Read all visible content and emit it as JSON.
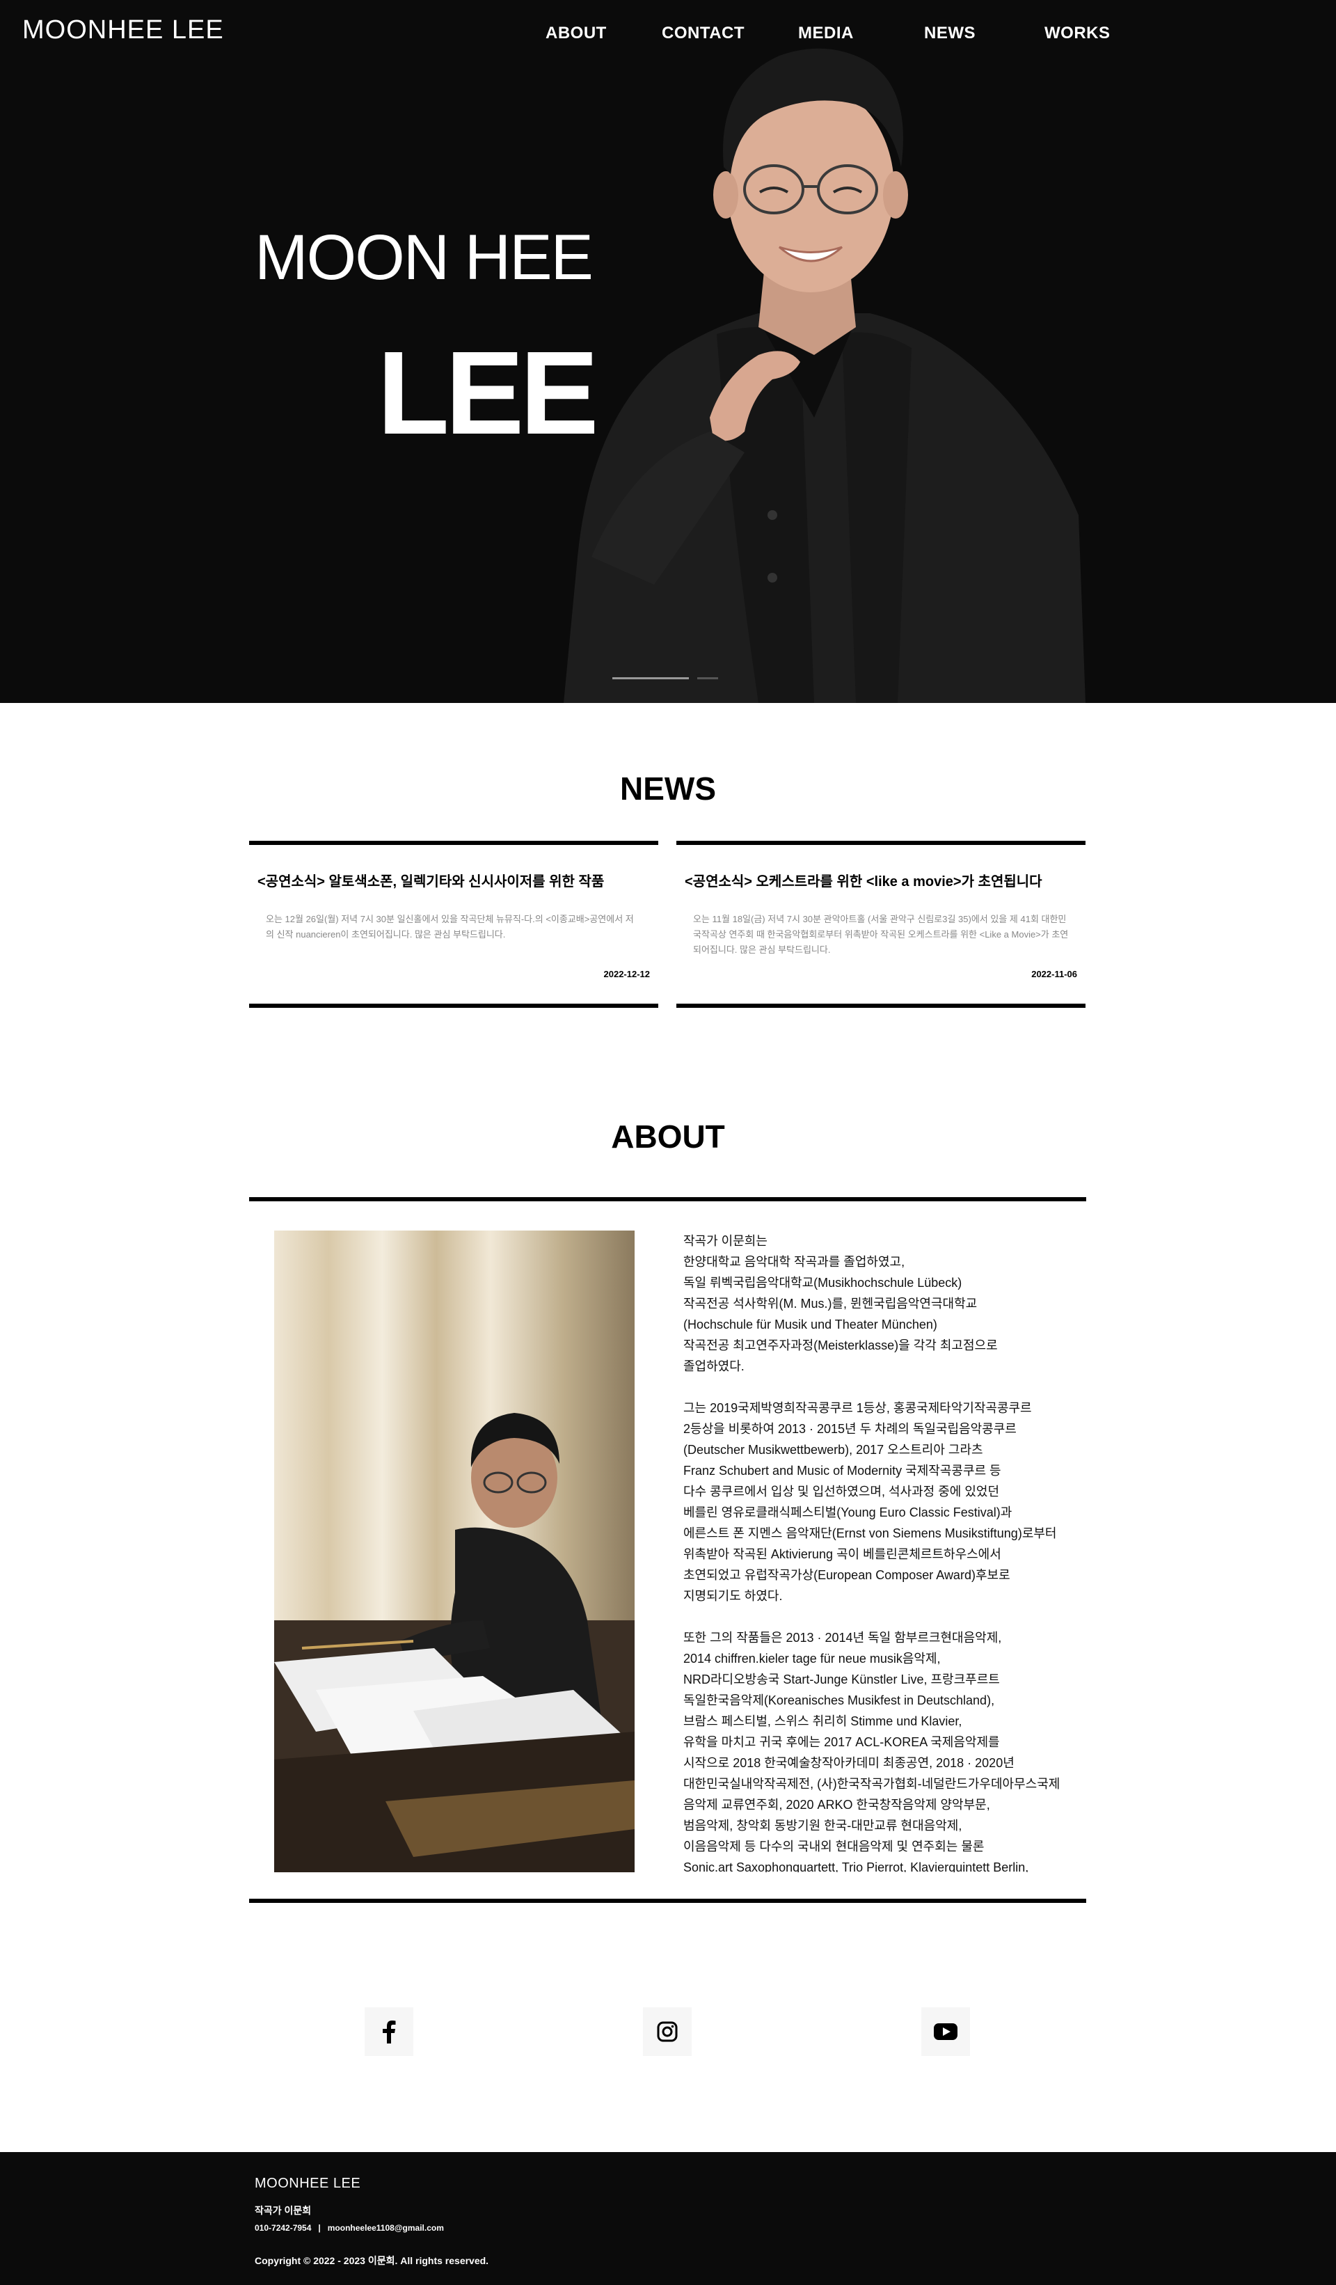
{
  "header": {
    "logo": "MOONHEE LEE",
    "nav": [
      {
        "label": "ABOUT"
      },
      {
        "label": "CONTACT"
      },
      {
        "label": "MEDIA"
      },
      {
        "label": "NEWS"
      },
      {
        "label": "WORKS"
      }
    ]
  },
  "hero": {
    "title_line1": "MOON HEE",
    "title_line2": "LEE"
  },
  "news": {
    "heading": "NEWS",
    "items": [
      {
        "title": "<공연소식> 알토색소폰, 일렉기타와 신시사이저를 위한 작품",
        "body": "오는 12월 26일(월) 저녁 7시 30분 일신홀에서 있을 작곡단체 뉴뮤직-다.의 <이종교배>공연에서 저의 신작 nuancieren이 초연되어집니다. 많은 관심 부탁드립니다.",
        "date": "2022-12-12"
      },
      {
        "title": "<공연소식> 오케스트라를 위한 <like a movie>가 초연됩니다",
        "body": "오는 11월 18일(금) 저녁 7시 30분 관악아트홀 (서울 관악구 신림로3길 35)에서 있을 제 41회 대한민국작곡상 연주회 때 한국음악협회로부터 위촉받아 작곡된 오케스트라를 위한 <Like a Movie>가 초연되어집니다. 많은 관심 부탁드립니다.",
        "date": "2022-11-06"
      }
    ]
  },
  "about": {
    "heading": "ABOUT",
    "paragraphs": [
      "작곡가 이문희는\n한양대학교 음악대학 작곡과를 졸업하였고,\n독일 뤼벡국립음악대학교(Musikhochschule Lübeck)\n작곡전공 석사학위(M. Mus.)를, 뮌헨국립음악연극대학교\n(Hochschule für Musik und Theater München)\n작곡전공 최고연주자과정(Meisterklasse)을 각각 최고점으로\n졸업하였다.",
      "그는 2019국제박영희작곡콩쿠르 1등상, 홍콩국제타악기작곡콩쿠르\n2등상을 비롯하여 2013 · 2015년 두 차례의 독일국립음악콩쿠르\n(Deutscher Musikwettbewerb), 2017 오스트리아 그라츠\nFranz Schubert and Music of Modernity 국제작곡콩쿠르 등\n다수 콩쿠르에서 입상 및 입선하였으며, 석사과정 중에 있었던\n베를린 영유로클래식페스티벌(Young Euro Classic Festival)과\n에른스트 폰 지멘스 음악재단(Ernst von Siemens Musikstiftung)로부터\n위촉받아 작곡된 Aktivierung 곡이 베를린콘체르트하우스에서\n초연되었고 유럽작곡가상(European Composer Award)후보로\n지명되기도 하였다.",
      "또한 그의 작품들은 2013 · 2014년 독일 함부르크현대음악제,\n2014 chiffren.kieler tage für neue musik음악제,\nNRD라디오방송국 Start-Junge Künstler Live, 프랑크푸르트\n독일한국음악제(Koreanisches Musikfest in Deutschland),\n브람스 페스티벌, 스위스 취리히 Stimme und Klavier,\n유학을 마치고 귀국 후에는 2017 ACL-KOREA 국제음악제를\n시작으로 2018 한국예술창작아카데미 최종공연, 2018 · 2020년\n대한민국실내악작곡제전, (사)한국작곡가협회-네덜란드가우데아무스국제\n음악제 교류연주회, 2020 ARKO 한국창작음악제 양악부문,\n범음악제, 창악회 동방기원 한국-대만교류 현대음악제,\n이음음악제 등 다수의 국내외 현대음악제 및 연주회는 물론\nSonic.art Saxophonquartett, Trio Pierrot, Klavierquintett Berlin,"
    ]
  },
  "social": [
    {
      "icon": "facebook-icon"
    },
    {
      "icon": "instagram-icon"
    },
    {
      "icon": "youtube-icon"
    }
  ],
  "footer": {
    "brand": "MOONHEE LEE",
    "name": "작곡가 이문희",
    "phone": "010-7242-7954",
    "separator": "|",
    "email": "moonheelee1108@gmail.com",
    "copyright": "Copyright © 2022 - 2023 이문희. All rights reserved."
  },
  "colors": {
    "hero_bg": "#0b0b0b",
    "text_dark": "#000000",
    "muted": "#888888"
  }
}
